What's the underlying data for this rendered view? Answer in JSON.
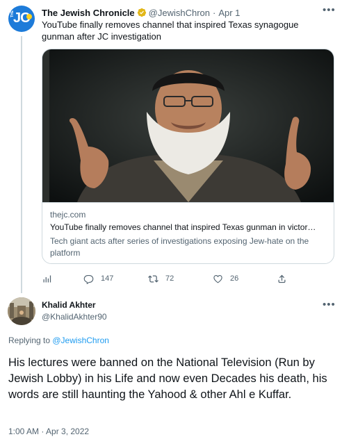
{
  "tweet1": {
    "avatar_text": "JC",
    "author_name": "The Jewish Chronicle",
    "handle": "@JewishChron",
    "separator": "·",
    "date": "Apr 1",
    "text": "YouTube finally removes channel that inspired Texas synagogue gunman after JC investigation",
    "card": {
      "domain": "thejc.com",
      "title": "YouTube finally removes channel that inspired Texas gunman in victor…",
      "description": "Tech giant acts after series of investigations exposing Jew-hate on the platform"
    },
    "actions": {
      "analytics_icon": "bar-chart-icon",
      "replies": "147",
      "retweets": "72",
      "likes": "26",
      "share_icon": "share-icon"
    }
  },
  "tweet2": {
    "author_name": "Khalid Akhter",
    "handle": "@KhalidAkhter90",
    "replying_prefix": "Replying to ",
    "replying_to": "@JewishChron",
    "text": "His lectures were banned on the National Television (Run by Jewish Lobby) in his Life and now even Decades his death, his words are still haunting the Yahood & other Ahl e Kuffar.",
    "timestamp": "1:00 AM · Apr 3, 2022"
  },
  "colors": {
    "brand_blue": "#1d9bf0",
    "secondary_text": "#536471",
    "border": "#cfd9de",
    "verified_gold": "#e2b719"
  }
}
